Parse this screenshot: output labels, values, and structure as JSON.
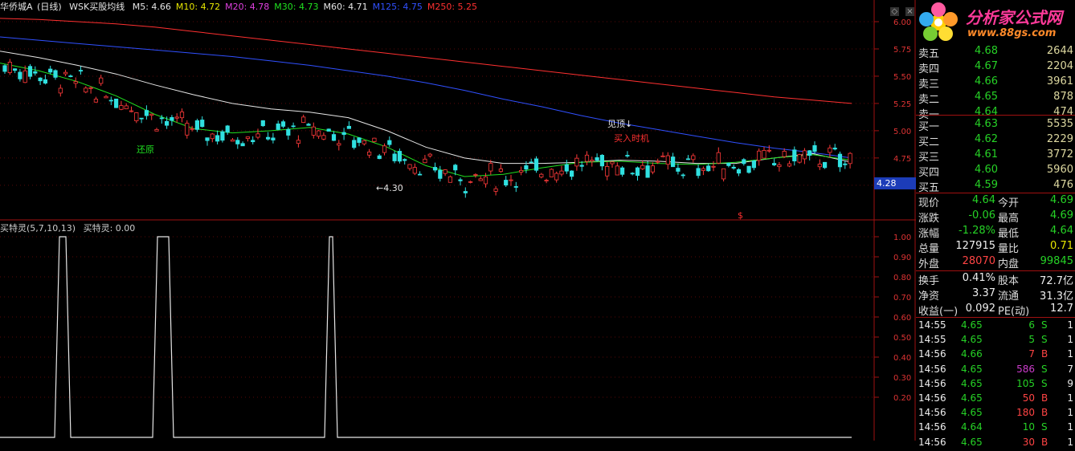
{
  "header": {
    "stock": "华侨城A",
    "period": "(日线)",
    "indicator": "WSK买股均线",
    "ma": [
      {
        "label": "M5: 4.66",
        "color": "#e6e6e6"
      },
      {
        "label": "M10: 4.72",
        "color": "#e6e600"
      },
      {
        "label": "M20: 4.78",
        "color": "#e040e0"
      },
      {
        "label": "M30: 4.73",
        "color": "#20e020"
      },
      {
        "label": "M60: 4.71",
        "color": "#e6e6e6"
      },
      {
        "label": "M125: 4.75",
        "color": "#3050ff"
      },
      {
        "label": "M250: 5.25",
        "color": "#ff3030"
      }
    ]
  },
  "sub_header": {
    "name": "买特灵(5,7,10,13)",
    "value": "买特灵: 0.00"
  },
  "annotations": {
    "low_label": "←4.30",
    "top_label": "见顶↓",
    "buy_label": "买入时机",
    "restore_label": "还原",
    "dollar": "$",
    "current_price": "4.28"
  },
  "logo": {
    "title": "分析家公式网",
    "url": "www.88gs.com"
  },
  "chart_data": [
    {
      "type": "line",
      "title": "",
      "y_axis_ticks": [
        "6.00",
        "5.75",
        "5.50",
        "5.25",
        "5.00",
        "4.75",
        "4.50"
      ],
      "ylim": [
        4.3,
        6.05
      ],
      "series": [
        {
          "name": "M250",
          "color": "#ff3030",
          "values": [
            6.03,
            6.02,
            6.0,
            5.98,
            5.95,
            5.91,
            5.87,
            5.83,
            5.79,
            5.75,
            5.71,
            5.67,
            5.63,
            5.59,
            5.55,
            5.51,
            5.47,
            5.43,
            5.39,
            5.35,
            5.31,
            5.28,
            5.25
          ]
        },
        {
          "name": "M125",
          "color": "#3050ff",
          "values": [
            5.86,
            5.83,
            5.8,
            5.77,
            5.74,
            5.71,
            5.68,
            5.64,
            5.6,
            5.55,
            5.5,
            5.44,
            5.37,
            5.29,
            5.22,
            5.14,
            5.07,
            5.01,
            4.95,
            4.89,
            4.84,
            4.8,
            4.75
          ]
        },
        {
          "name": "M60",
          "color": "#e6e6e6",
          "values": [
            5.73,
            5.67,
            5.6,
            5.52,
            5.42,
            5.33,
            5.25,
            5.2,
            5.17,
            5.12,
            5.0,
            4.85,
            4.75,
            4.7,
            4.7,
            4.71,
            4.73,
            4.72,
            4.7,
            4.7,
            4.75,
            4.79,
            4.71
          ]
        },
        {
          "name": "M30",
          "color": "#20e020",
          "values": [
            5.62,
            5.55,
            5.45,
            5.32,
            5.15,
            5.02,
            4.98,
            5.0,
            5.03,
            4.97,
            4.85,
            4.68,
            4.58,
            4.6,
            4.66,
            4.71,
            4.72,
            4.7,
            4.69,
            4.71,
            4.75,
            4.78,
            4.73
          ]
        }
      ]
    },
    {
      "type": "line",
      "title": "",
      "y_axis_ticks": [
        "1.00",
        "0.90",
        "0.80",
        "0.70",
        "0.60",
        "0.50",
        "0.40",
        "0.30",
        "0.20"
      ],
      "ylim": [
        0,
        1.05
      ],
      "x": [
        0,
        68,
        74,
        82,
        88,
        190,
        196,
        210,
        216,
        404,
        410,
        414,
        420,
        1060
      ],
      "series": [
        {
          "name": "买特灵",
          "color": "#e6e6e6",
          "values": [
            0,
            0,
            1,
            1,
            0,
            0,
            1,
            1,
            0,
            0,
            1,
            1,
            0,
            0
          ]
        }
      ]
    }
  ],
  "quotes": {
    "sells": [
      {
        "label": "卖五",
        "price": "4.68",
        "vol": "2644"
      },
      {
        "label": "卖四",
        "price": "4.67",
        "vol": "2204"
      },
      {
        "label": "卖三",
        "price": "4.66",
        "vol": "3961"
      },
      {
        "label": "卖二",
        "price": "4.65",
        "vol": "878"
      },
      {
        "label": "卖一",
        "price": "4.64",
        "vol": "474"
      }
    ],
    "buys": [
      {
        "label": "买一",
        "price": "4.63",
        "vol": "5535"
      },
      {
        "label": "买二",
        "price": "4.62",
        "vol": "2229"
      },
      {
        "label": "买三",
        "price": "4.61",
        "vol": "3772"
      },
      {
        "label": "买四",
        "price": "4.60",
        "vol": "5960"
      },
      {
        "label": "买五",
        "price": "4.59",
        "vol": "476"
      }
    ]
  },
  "stats": [
    {
      "l1": "现价",
      "v1": "4.64",
      "c1": "green",
      "l2": "今开",
      "v2": "4.69",
      "c2": "green"
    },
    {
      "l1": "涨跌",
      "v1": "-0.06",
      "c1": "green",
      "l2": "最高",
      "v2": "4.69",
      "c2": "green"
    },
    {
      "l1": "涨幅",
      "v1": "-1.28%",
      "c1": "green",
      "l2": "最低",
      "v2": "4.64",
      "c2": "green"
    },
    {
      "l1": "总量",
      "v1": "127915",
      "c1": "white",
      "l2": "量比",
      "v2": "0.71",
      "c2": "yellow"
    },
    {
      "l1": "外盘",
      "v1": "28070",
      "c1": "red",
      "l2": "内盘",
      "v2": "99845",
      "c2": "green"
    }
  ],
  "stats2": [
    {
      "l1": "换手",
      "v1": "0.41%",
      "l2": "股本",
      "v2": "72.7亿"
    },
    {
      "l1": "净资",
      "v1": "3.37",
      "l2": "流通",
      "v2": "31.3亿"
    },
    {
      "l1": "收益(一)",
      "v1": "0.092",
      "l2": "PE(动)",
      "v2": "12.7"
    }
  ],
  "ticks": [
    {
      "time": "14:55",
      "price": "4.65",
      "vol": "6",
      "vc": "green",
      "bs": "S",
      "n": "1"
    },
    {
      "time": "14:55",
      "price": "4.65",
      "vol": "5",
      "vc": "green",
      "bs": "S",
      "n": "1"
    },
    {
      "time": "14:56",
      "price": "4.66",
      "vol": "7",
      "vc": "red",
      "bs": "B",
      "n": "1"
    },
    {
      "time": "14:56",
      "price": "4.65",
      "vol": "586",
      "vc": "purple",
      "bs": "S",
      "n": "7"
    },
    {
      "time": "14:56",
      "price": "4.65",
      "vol": "105",
      "vc": "green",
      "bs": "S",
      "n": "9"
    },
    {
      "time": "14:56",
      "price": "4.65",
      "vol": "50",
      "vc": "red",
      "bs": "B",
      "n": "1"
    },
    {
      "time": "14:56",
      "price": "4.65",
      "vol": "180",
      "vc": "red",
      "bs": "B",
      "n": "1"
    },
    {
      "time": "14:56",
      "price": "4.64",
      "vol": "10",
      "vc": "green",
      "bs": "S",
      "n": "1"
    },
    {
      "time": "14:56",
      "price": "4.65",
      "vol": "30",
      "vc": "red",
      "bs": "B",
      "n": "1"
    }
  ]
}
